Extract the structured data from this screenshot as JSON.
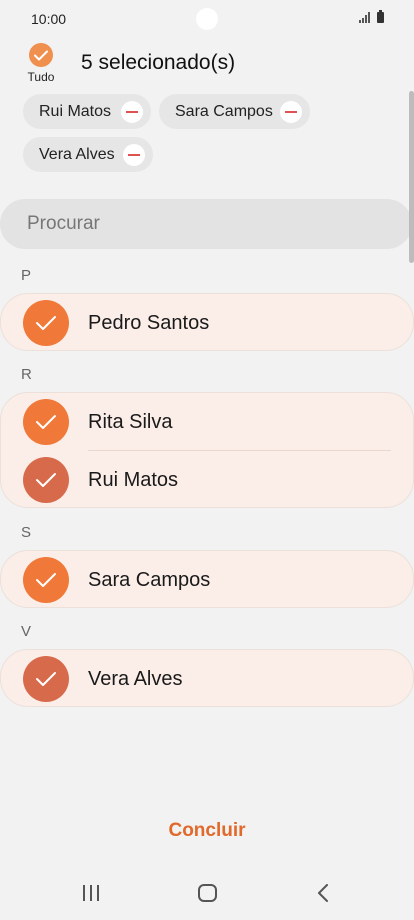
{
  "status_bar": {
    "time": "10:00"
  },
  "header": {
    "select_all_label": "Tudo",
    "selected_count": "5 selecionado(s)"
  },
  "chips": [
    {
      "label": "Rui Matos"
    },
    {
      "label": "Sara Campos"
    },
    {
      "label": "Vera Alves"
    }
  ],
  "search": {
    "placeholder": "Procurar"
  },
  "sections": [
    {
      "letter": "P",
      "contacts": [
        {
          "name": "Pedro Santos"
        }
      ]
    },
    {
      "letter": "R",
      "contacts": [
        {
          "name": "Rita Silva"
        },
        {
          "name": "Rui Matos"
        }
      ]
    },
    {
      "letter": "S",
      "contacts": [
        {
          "name": "Sara Campos"
        }
      ]
    },
    {
      "letter": "V",
      "contacts": [
        {
          "name": "Vera Alves"
        }
      ]
    }
  ],
  "footer": {
    "done_label": "Concluir"
  },
  "colors": {
    "accent": "#e0692b",
    "check_primary": "#f07839",
    "check_secondary": "#d86a4c",
    "selected_row_bg": "#fbeee8"
  }
}
